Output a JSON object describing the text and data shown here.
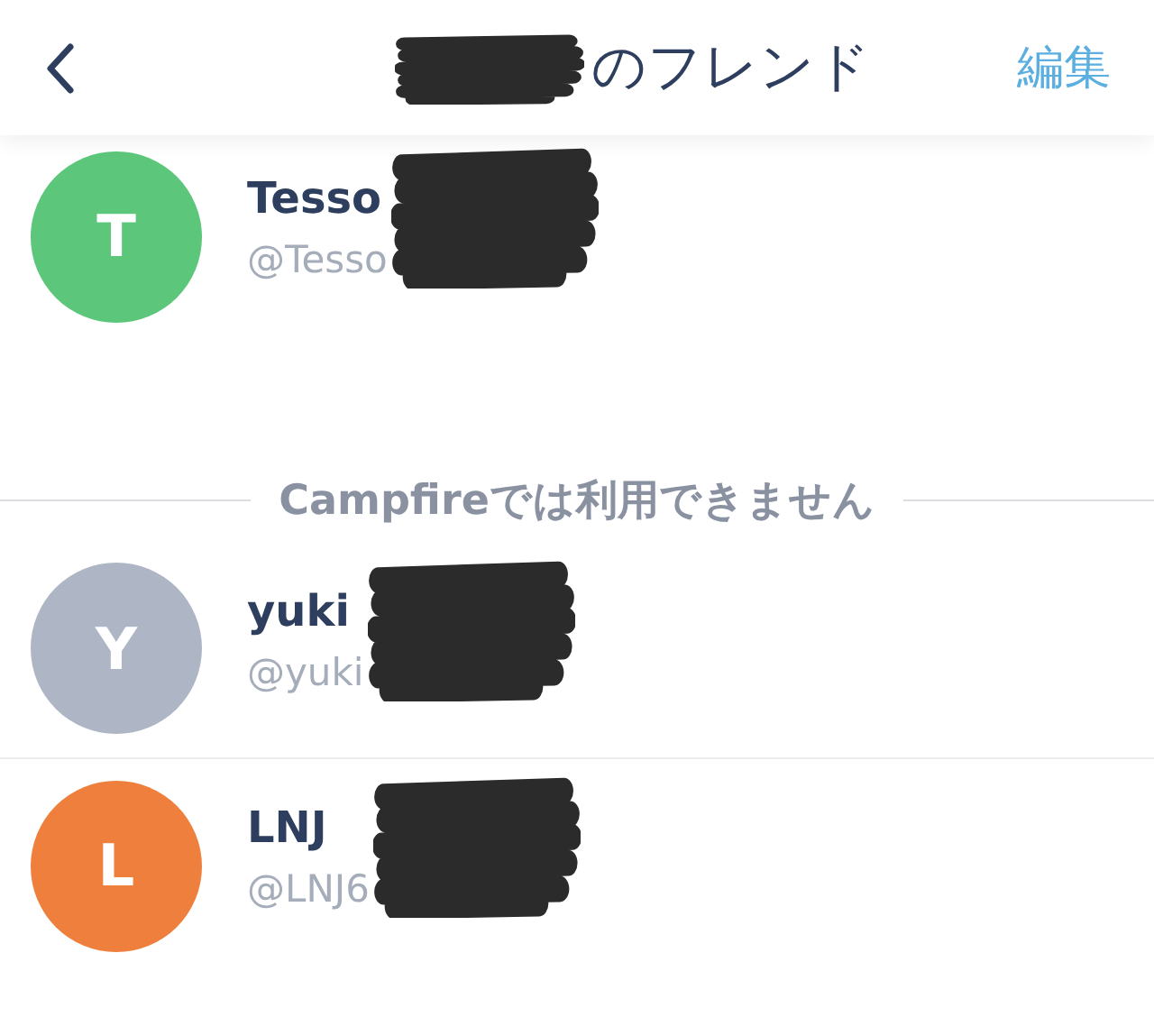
{
  "header": {
    "title": "のフレンド",
    "edit_button": "編集"
  },
  "friends": [
    {
      "initial": "T",
      "name": "Tesso",
      "handle": "@Tesso",
      "color": "#5cc77a"
    }
  ],
  "unavailable_section": {
    "label": "Campfireでは利用できません",
    "friends": [
      {
        "initial": "Y",
        "name": "yuki",
        "handle": "@yuki",
        "color": "#aeb6c6"
      },
      {
        "initial": "L",
        "name": "LNJ",
        "handle": "@LNJ6",
        "color": "#ee7f3c"
      }
    ]
  }
}
